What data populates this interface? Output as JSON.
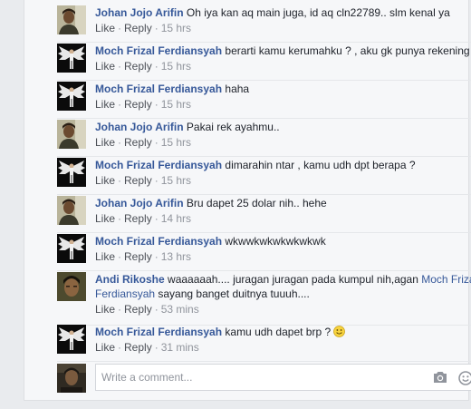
{
  "comments": [
    {
      "author": "Johan Jojo Arifin",
      "text": "Oh iya kan aq main juga, id aq cln22789.. slm kenal ya",
      "like": "Like",
      "reply": "Reply",
      "time": "15 hrs",
      "avatar": "johan"
    },
    {
      "author": "Moch Frizal Ferdiansyah",
      "text": "berarti kamu kerumahku ? , aku gk punya rekening",
      "like": "Like",
      "reply": "Reply",
      "time": "15 hrs",
      "avatar": "frizal"
    },
    {
      "author": "Moch Frizal Ferdiansyah",
      "text": "haha",
      "like": "Like",
      "reply": "Reply",
      "time": "15 hrs",
      "avatar": "frizal"
    },
    {
      "author": "Johan Jojo Arifin",
      "text": "Pakai rek ayahmu..",
      "like": "Like",
      "reply": "Reply",
      "time": "15 hrs",
      "avatar": "johan"
    },
    {
      "author": "Moch Frizal Ferdiansyah",
      "text": "dimarahin ntar , kamu udh dpt berapa ?",
      "like": "Like",
      "reply": "Reply",
      "time": "15 hrs",
      "avatar": "frizal"
    },
    {
      "author": "Johan Jojo Arifin",
      "text": "Bru dapet 25 dolar nih.. hehe",
      "like": "Like",
      "reply": "Reply",
      "time": "14 hrs",
      "avatar": "johan"
    },
    {
      "author": "Moch Frizal Ferdiansyah",
      "text": "wkwwkwkwkwkwkwk",
      "like": "Like",
      "reply": "Reply",
      "time": "13 hrs",
      "avatar": "frizal"
    },
    {
      "author": "Andi Rikoshe",
      "text_before": "waaaaaah.... juragan juragan pada kumpul nih,agan ",
      "mention": "Moch Frizal Ferdiansyah",
      "text_after": " sayang banget duitnya tuuuh....",
      "like": "Like",
      "reply": "Reply",
      "time": "53 mins",
      "avatar": "andi"
    },
    {
      "author": "Moch Frizal Ferdiansyah",
      "text": "kamu udh dapet brp ?",
      "like": "Like",
      "reply": "Reply",
      "time": "31 mins",
      "avatar": "frizal",
      "emoji": "smile-emoji"
    }
  ],
  "composer": {
    "placeholder": "Write a comment...",
    "camera_icon": "camera-icon",
    "emoji_icon": "emoji-icon"
  },
  "colors": {
    "link": "#365899",
    "meta": "#90949c",
    "background": "#f6f7f9"
  }
}
